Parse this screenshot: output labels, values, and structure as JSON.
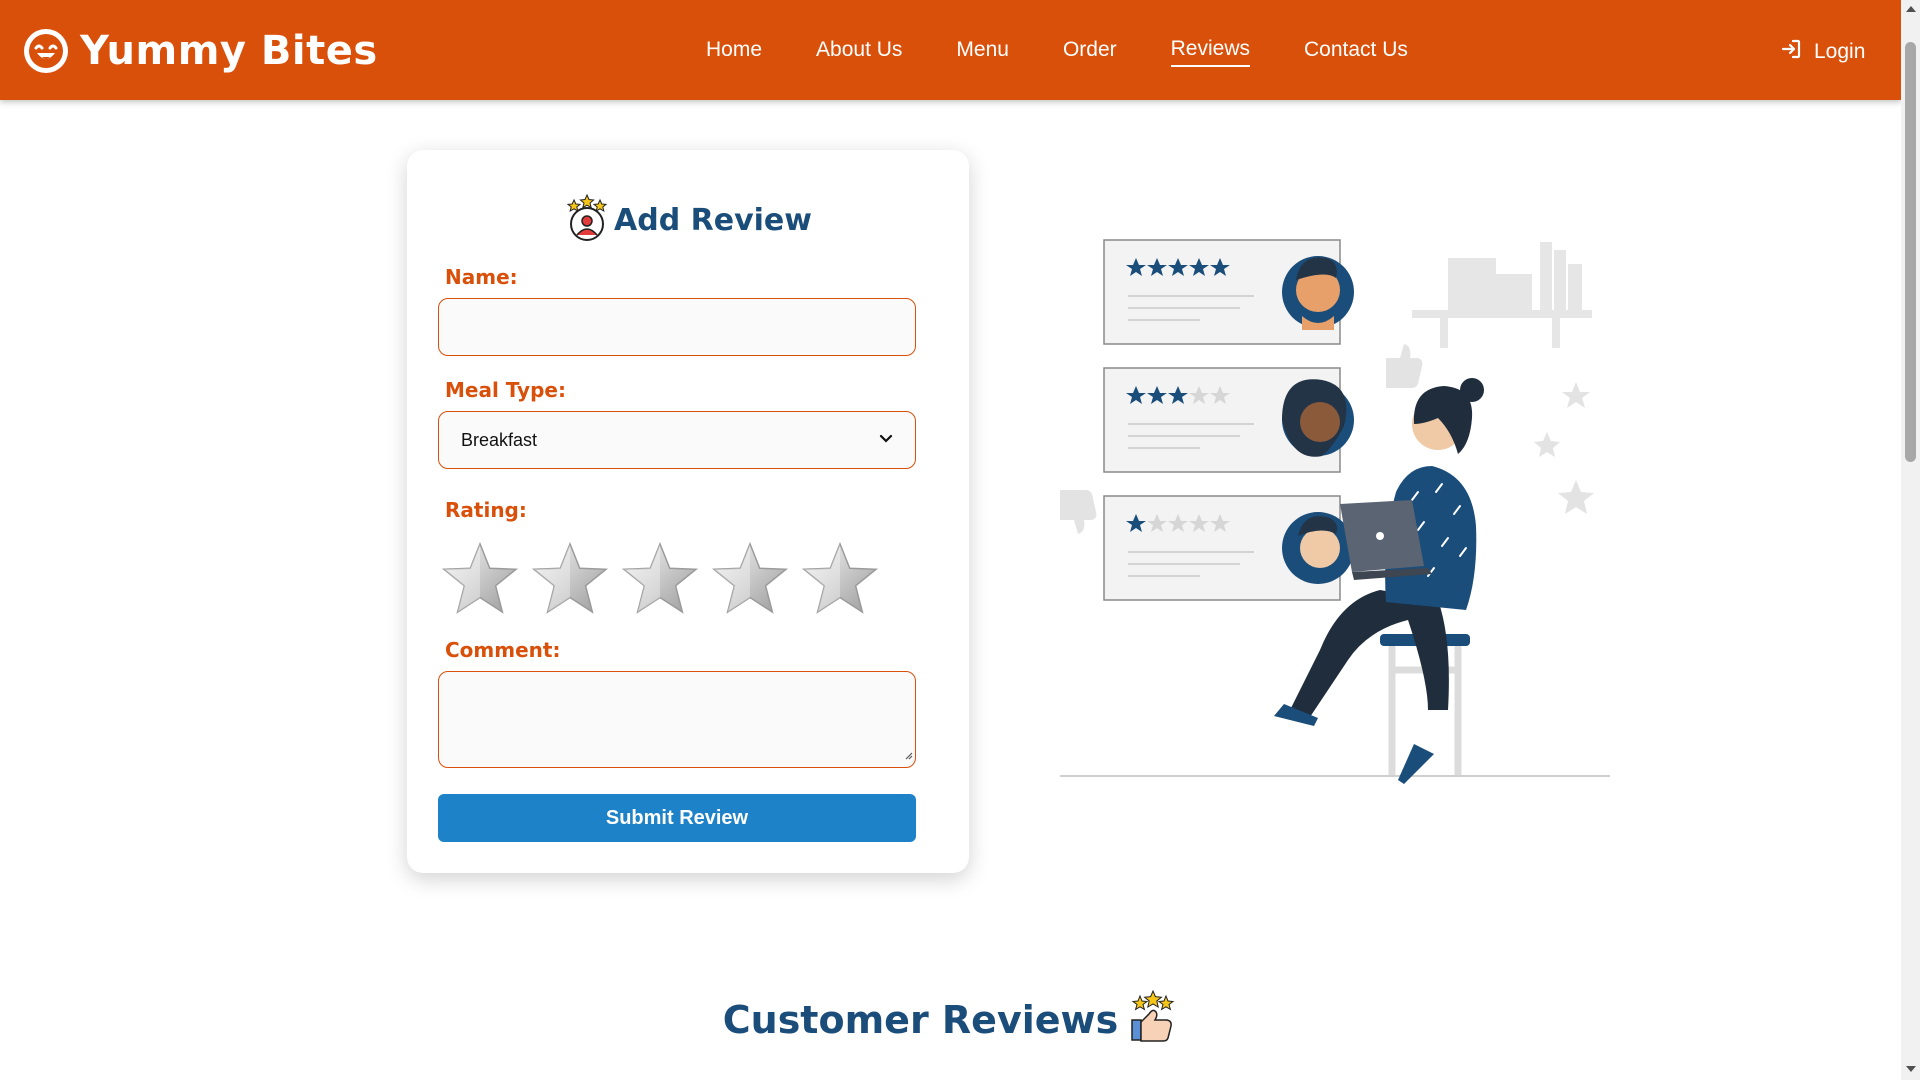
{
  "brand": {
    "title": "Yummy Bites",
    "icon": "smiley-face-icon"
  },
  "nav": {
    "items": [
      {
        "label": "Home",
        "active": false
      },
      {
        "label": "About Us",
        "active": false
      },
      {
        "label": "Menu",
        "active": false
      },
      {
        "label": "Order",
        "active": false
      },
      {
        "label": "Reviews",
        "active": true
      },
      {
        "label": "Contact Us",
        "active": false
      }
    ],
    "login_label": "Login",
    "login_icon": "sign-in-icon"
  },
  "form": {
    "title": "Add Review",
    "title_icon": "reviewer-stars-icon",
    "name_label": "Name:",
    "name_value": "",
    "meal_type_label": "Meal Type:",
    "meal_type_value": "Breakfast",
    "rating_label": "Rating:",
    "rating_value": 0,
    "rating_max": 5,
    "comment_label": "Comment:",
    "comment_value": "",
    "submit_label": "Submit Review"
  },
  "illustration": {
    "review_cards": [
      {
        "stars": 5
      },
      {
        "stars": 3
      },
      {
        "stars": 1
      }
    ]
  },
  "customer_reviews": {
    "title": "Customer Reviews",
    "icon": "thumbs-up-stars-icon"
  },
  "colors": {
    "primary": "#d9500b",
    "heading": "#1b4d7a",
    "button": "#1e82c8",
    "star_fill": "#1b4d7a"
  }
}
